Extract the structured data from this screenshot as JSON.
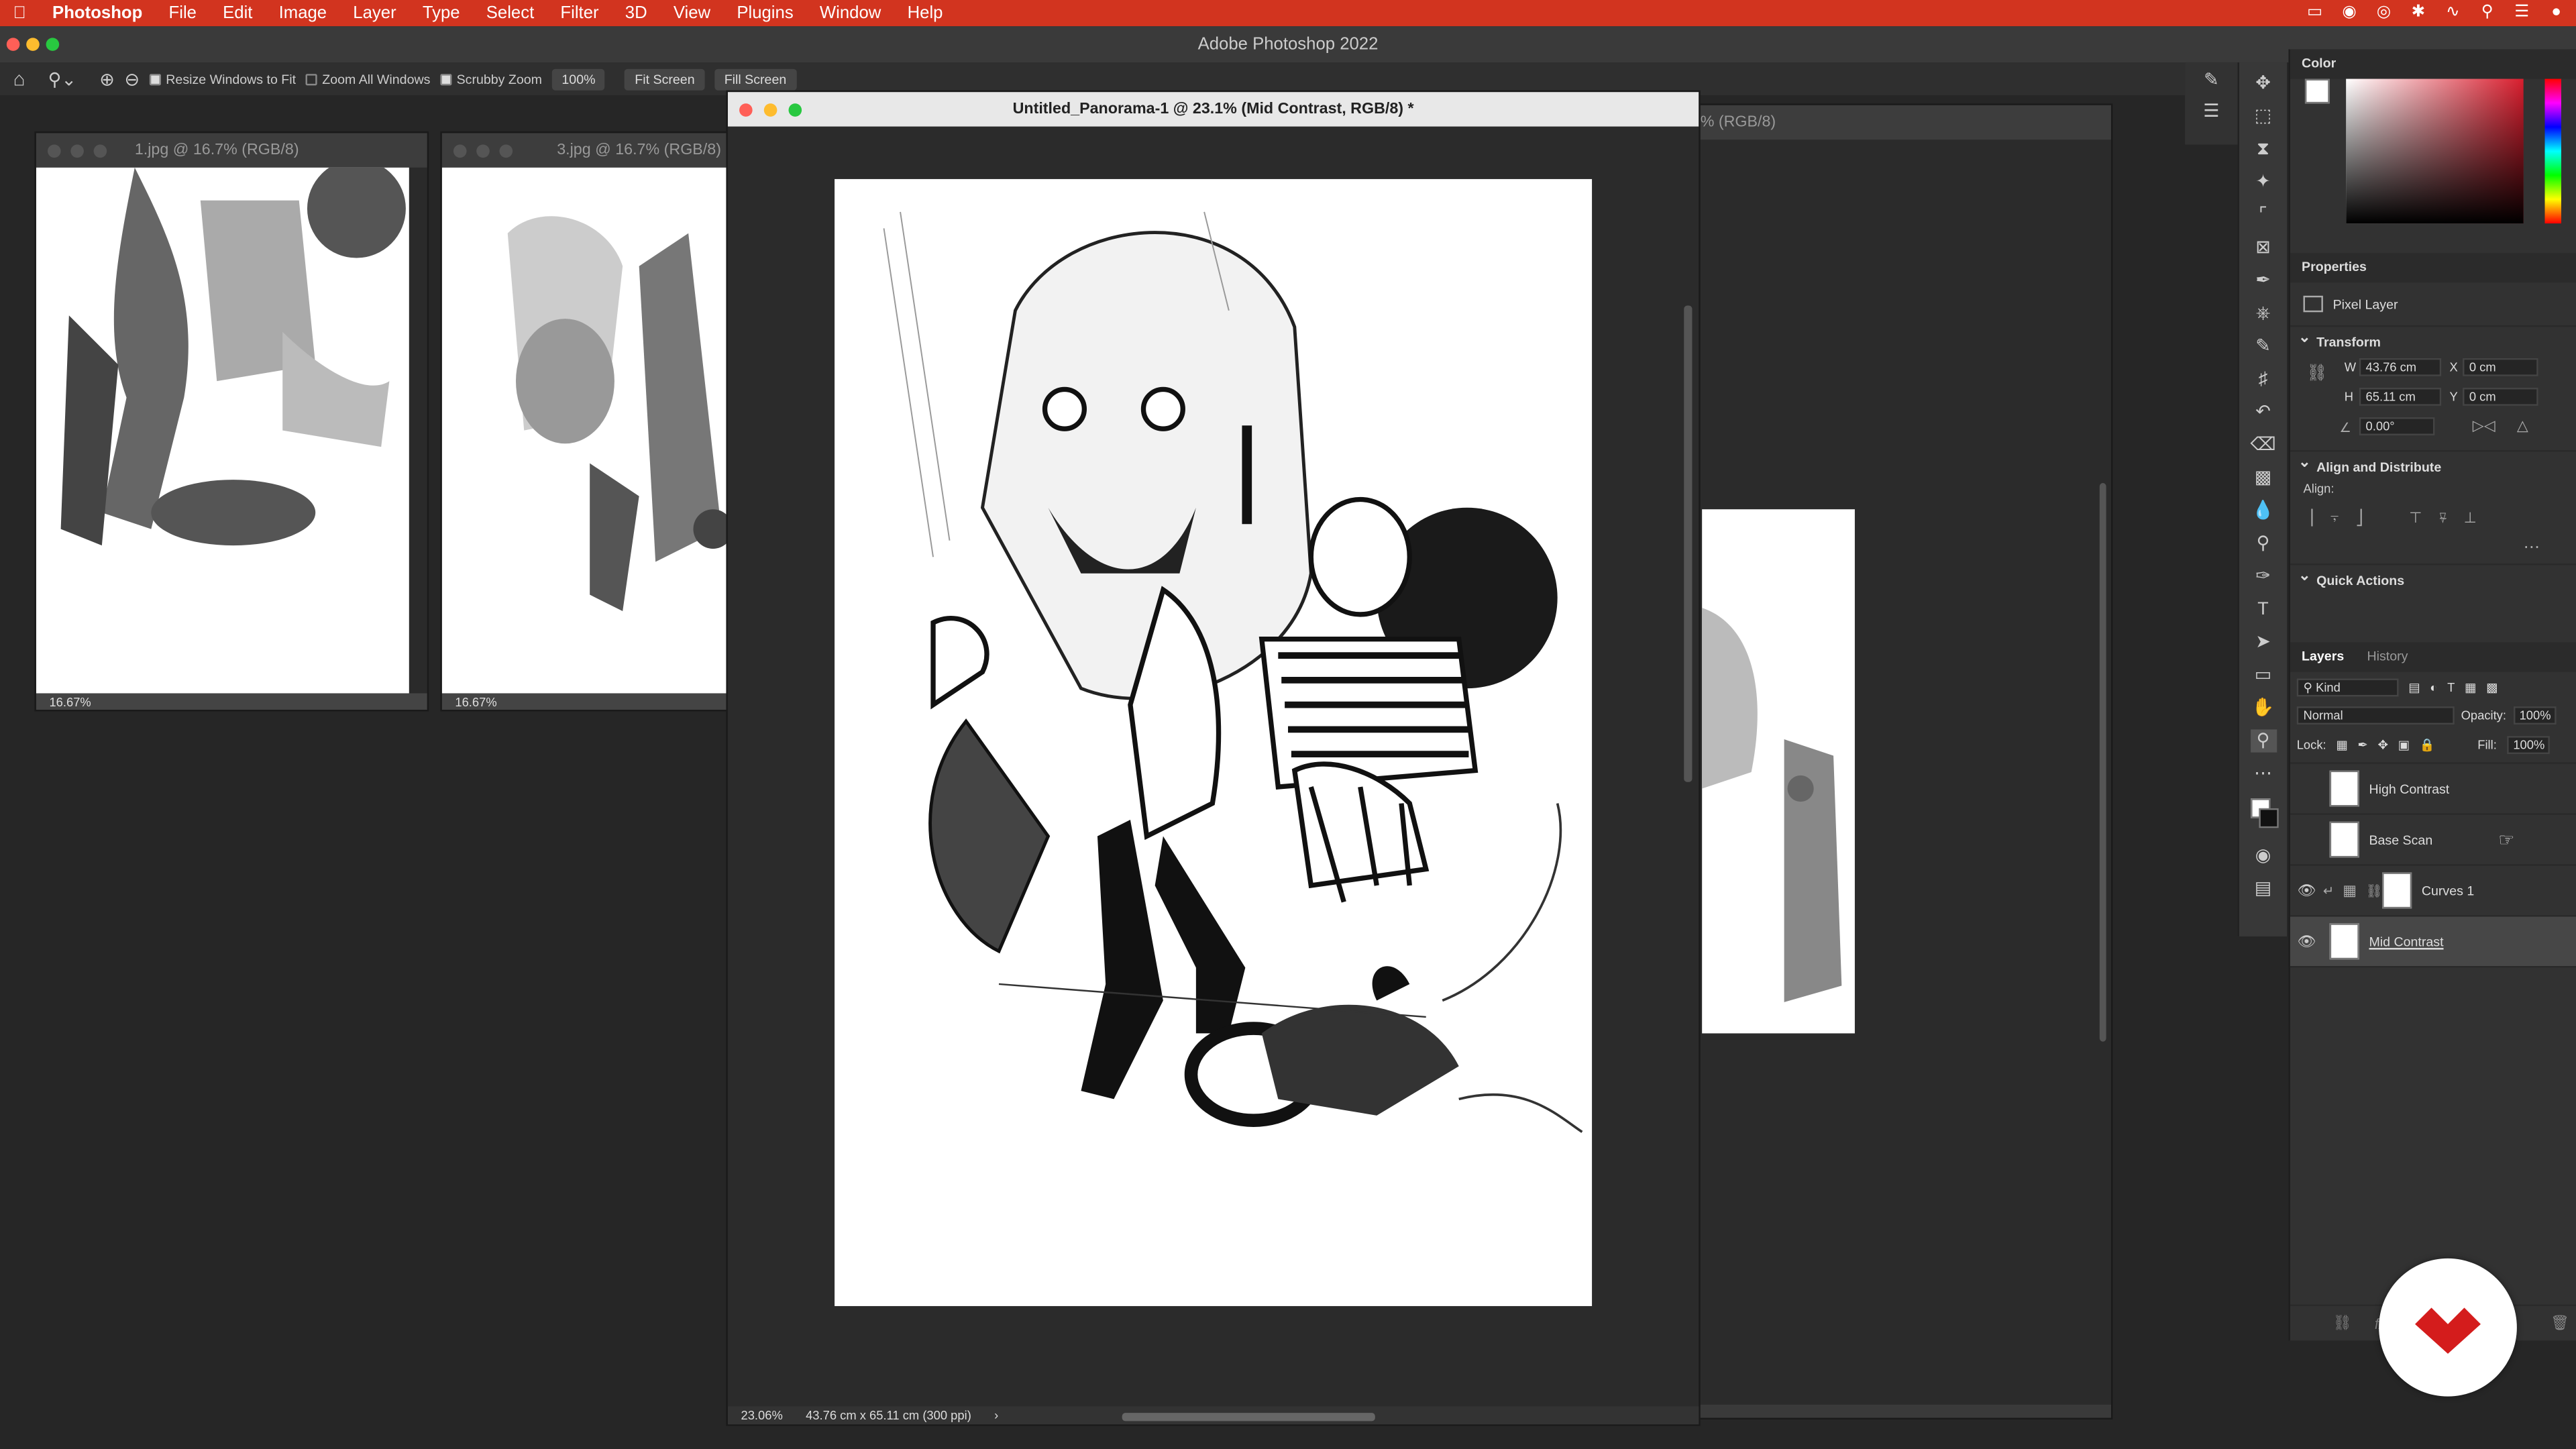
{
  "menubar": {
    "app": "Photoshop",
    "items": [
      "File",
      "Edit",
      "Image",
      "Layer",
      "Type",
      "Select",
      "Filter",
      "3D",
      "View",
      "Plugins",
      "Window",
      "Help"
    ]
  },
  "window": {
    "title": "Adobe Photoshop 2022"
  },
  "options": {
    "resize_windows": "Resize Windows to Fit",
    "zoom_all": "Zoom All Windows",
    "scrubby_zoom": "Scrubby Zoom",
    "zoom_value": "100%",
    "fit_screen": "Fit Screen",
    "fill_screen": "Fill Screen"
  },
  "docs": [
    {
      "title": "1.jpg @ 16.7% (RGB/8)",
      "zoom": "16.67%"
    },
    {
      "title": "3.jpg @ 16.7% (RGB/8)",
      "zoom": "16.67%"
    },
    {
      "title": "Untitled_Panorama-1 @ 23.1% (Mid Contrast, RGB/8) *",
      "zoom": "23.06%",
      "info": "43.76 cm x 65.11 cm (300 ppi)"
    },
    {
      "title": "% (RGB/8)"
    }
  ],
  "color_panel": {
    "title": "Color"
  },
  "properties": {
    "title": "Properties",
    "kind": "Pixel Layer",
    "transform": "Transform",
    "w_label": "W",
    "w": "43.76 cm",
    "x_label": "X",
    "x": "0 cm",
    "h_label": "H",
    "h": "65.11 cm",
    "y_label": "Y",
    "y": "0 cm",
    "angle": "0.00°",
    "align_section": "Align and Distribute",
    "align_label": "Align:",
    "quick_actions": "Quick Actions"
  },
  "layers": {
    "tab_layers": "Layers",
    "tab_history": "History",
    "filter": "Kind",
    "blend": "Normal",
    "opacity_label": "Opacity:",
    "opacity": "100%",
    "lock_label": "Lock:",
    "fill_label": "Fill:",
    "fill": "100%",
    "items": [
      {
        "name": "High Contrast",
        "visible": false
      },
      {
        "name": "Base Scan",
        "visible": false
      },
      {
        "name": "Curves 1",
        "visible": true
      },
      {
        "name": "Mid Contrast",
        "visible": true
      }
    ]
  },
  "colors": {
    "menubar": "#d2341f",
    "badge": "#d41c1c"
  }
}
